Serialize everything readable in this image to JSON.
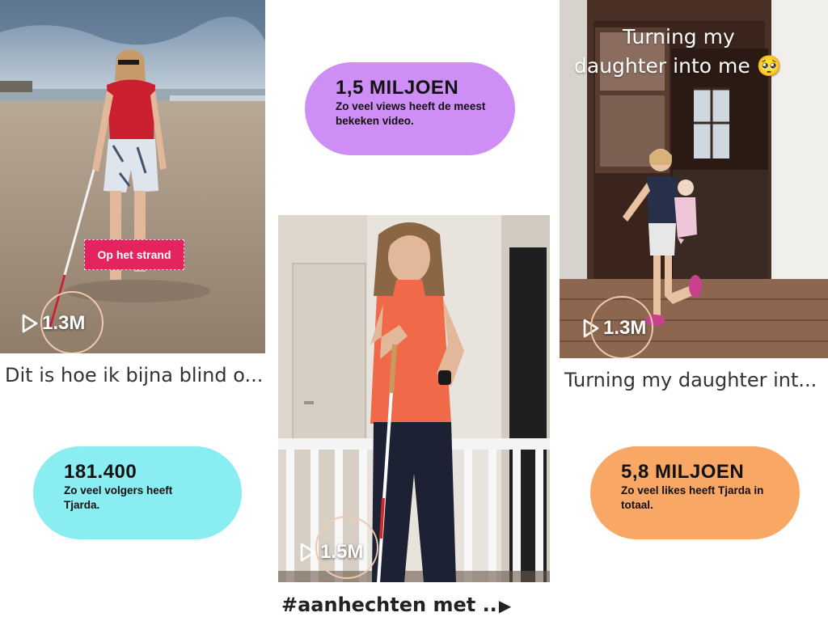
{
  "tiles": [
    {
      "id": "beach",
      "views": "1.3M",
      "sticker": "Op het strand",
      "caption": "Dit is hoe ik bijna blind o..."
    },
    {
      "id": "mom",
      "views": "1.5M",
      "caption": "#aanhechten met ..",
      "caption_arrow": "▶"
    },
    {
      "id": "door",
      "views": "1.3M",
      "overlay_line1": "Turning my",
      "overlay_line2": "daughter into me 🥺",
      "caption": "Turning my daughter int..."
    }
  ],
  "stats": {
    "views": {
      "value": "1,5 MILJOEN",
      "description": "Zo veel views heeft de meest bekeken video."
    },
    "followers": {
      "value": "181.400",
      "description": "Zo veel volgers heeft Tjarda."
    },
    "likes": {
      "value": "5,8 MILJOEN",
      "description": "Zo veel likes heeft Tjarda in totaal."
    }
  },
  "colors": {
    "views_bubble": "#cf8ef5",
    "followers_bubble": "#89edf2",
    "likes_bubble": "#f9a764",
    "sticker": "#e4245c",
    "highlight_ring": "#f0c9b0"
  },
  "icons": {
    "views": "play-icon"
  }
}
